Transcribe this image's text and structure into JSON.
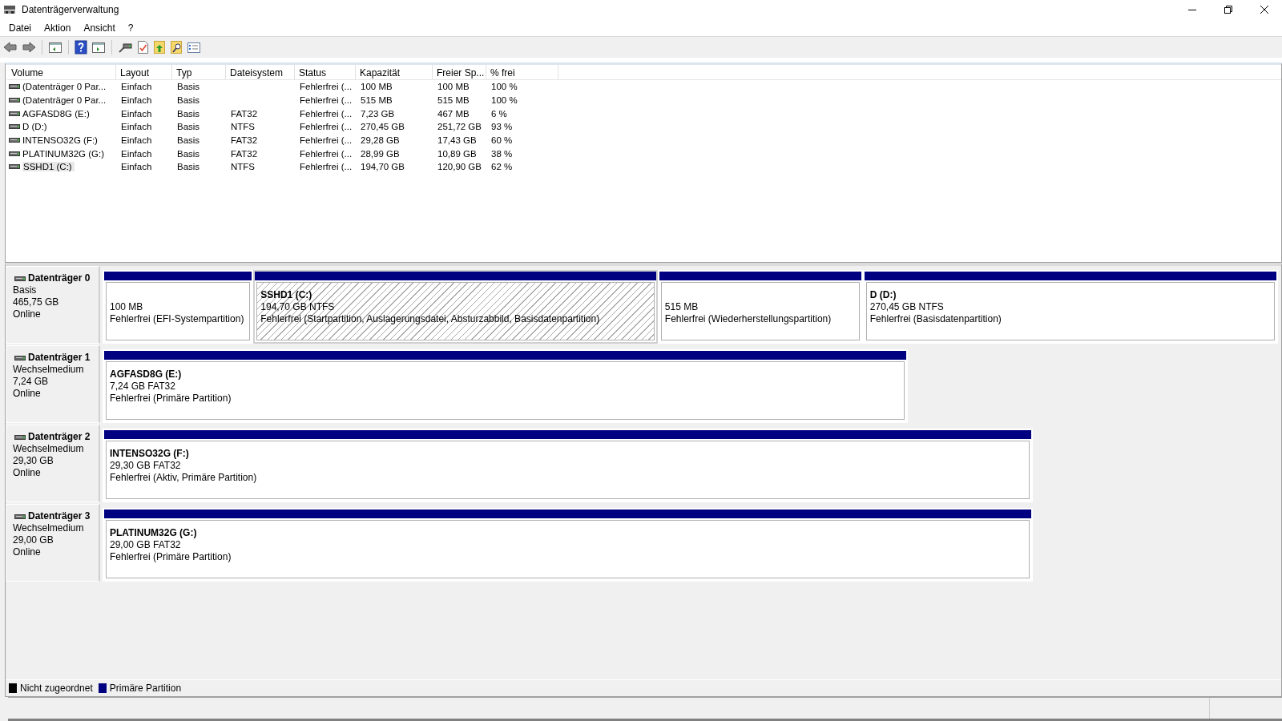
{
  "window": {
    "title": "Datenträgerverwaltung"
  },
  "menu": [
    "Datei",
    "Aktion",
    "Ansicht",
    "?"
  ],
  "table": {
    "columns": [
      "Volume",
      "Layout",
      "Typ",
      "Dateisystem",
      "Status",
      "Kapazität",
      "Freier Sp...",
      "% frei"
    ],
    "rows": [
      {
        "cells": [
          "(Datenträger 0 Par...",
          "Einfach",
          "Basis",
          "",
          "Fehlerfrei (...",
          "100 MB",
          "100 MB",
          "100 %"
        ],
        "selected": false
      },
      {
        "cells": [
          "(Datenträger 0 Par...",
          "Einfach",
          "Basis",
          "",
          "Fehlerfrei (...",
          "515 MB",
          "515 MB",
          "100 %"
        ],
        "selected": false
      },
      {
        "cells": [
          "AGFASD8G (E:)",
          "Einfach",
          "Basis",
          "FAT32",
          "Fehlerfrei (...",
          "7,23 GB",
          "467 MB",
          "6 %"
        ],
        "selected": false
      },
      {
        "cells": [
          "D (D:)",
          "Einfach",
          "Basis",
          "NTFS",
          "Fehlerfrei (...",
          "270,45 GB",
          "251,72 GB",
          "93 %"
        ],
        "selected": false
      },
      {
        "cells": [
          "INTENSO32G (F:)",
          "Einfach",
          "Basis",
          "FAT32",
          "Fehlerfrei (...",
          "29,28 GB",
          "17,43 GB",
          "60 %"
        ],
        "selected": false
      },
      {
        "cells": [
          "PLATINUM32G (G:)",
          "Einfach",
          "Basis",
          "FAT32",
          "Fehlerfrei (...",
          "28,99 GB",
          "10,89 GB",
          "38 %"
        ],
        "selected": false
      },
      {
        "cells": [
          "SSHD1 (C:)",
          "Einfach",
          "Basis",
          "NTFS",
          "Fehlerfrei (...",
          "194,70 GB",
          "120,90 GB",
          "62 %"
        ],
        "selected": true
      }
    ]
  },
  "disks": [
    {
      "name": "Datenträger 0",
      "type": "Basis",
      "size": "465,75 GB",
      "status": "Online",
      "partitions": [
        {
          "size": "100 MB",
          "status": "Fehlerfrei (EFI-Systempartition)",
          "selected": false
        },
        {
          "name": "SSHD1  (C:)",
          "size": "194,70 GB NTFS",
          "status": "Fehlerfrei (Startpartition, Auslagerungsdatei, Absturzabbild, Basisdatenpartition)",
          "selected": true
        },
        {
          "size": "515 MB",
          "status": "Fehlerfrei (Wiederherstellungspartition)",
          "selected": false
        },
        {
          "name": "D  (D:)",
          "size": "270,45 GB NTFS",
          "status": "Fehlerfrei (Basisdatenpartition)",
          "selected": false
        }
      ]
    },
    {
      "name": "Datenträger 1",
      "type": "Wechselmedium",
      "size": "7,24 GB",
      "status": "Online",
      "partitions": [
        {
          "name": "AGFASD8G  (E:)",
          "size": "7,24 GB FAT32",
          "status": "Fehlerfrei (Primäre Partition)",
          "selected": false
        }
      ]
    },
    {
      "name": "Datenträger 2",
      "type": "Wechselmedium",
      "size": "29,30 GB",
      "status": "Online",
      "partitions": [
        {
          "name": "INTENSO32G  (F:)",
          "size": "29,30 GB FAT32",
          "status": "Fehlerfrei (Aktiv, Primäre Partition)",
          "selected": false
        }
      ]
    },
    {
      "name": "Datenträger 3",
      "type": "Wechselmedium",
      "size": "29,00 GB",
      "status": "Online",
      "partitions": [
        {
          "name": "PLATINUM32G  (G:)",
          "size": "29,00 GB FAT32",
          "status": "Fehlerfrei (Primäre Partition)",
          "selected": false
        }
      ]
    }
  ],
  "legend": [
    {
      "label": "Nicht zugeordnet",
      "color": "#000000"
    },
    {
      "label": "Primäre Partition",
      "color": "#000080"
    }
  ]
}
